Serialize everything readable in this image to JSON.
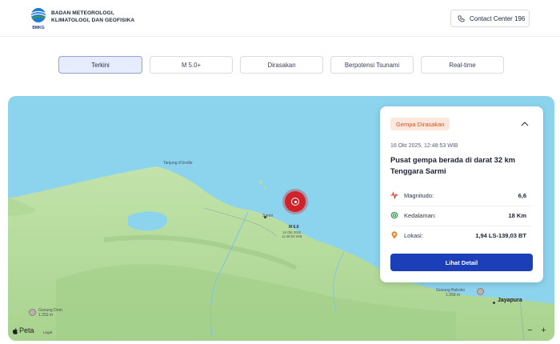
{
  "header": {
    "brand_lines": [
      "BADAN METEOROLOGI,",
      "KLIMATOLOGI, DAN GEOFISIKA"
    ],
    "logo_text": "BMKG",
    "contact_label": "Contact Center 196",
    "contact_icon": "phone-icon"
  },
  "tabs": [
    {
      "label": "Terkini",
      "active": true
    },
    {
      "label": "M 5.0+",
      "active": false
    },
    {
      "label": "Dirasakan",
      "active": false
    },
    {
      "label": "Berpotensi Tsunami",
      "active": false
    },
    {
      "label": "Real-time",
      "active": false
    }
  ],
  "map": {
    "labels": {
      "cape": "Tanjung d'Urville",
      "sarmi": "Sarmi",
      "quake_mag": "M 6.6",
      "quake_date": "16 Okt 2025",
      "quake_time": "12:48:53 WIB",
      "gunung_dom": "Gunung Dom",
      "gunung_dom_elev": "1.253 m",
      "gunung_bal": "Gunung Baboko",
      "gunung_bal_elev": "1.358 m",
      "jayapura": "Jayapura"
    },
    "attribution": "Peta",
    "legal": "Legal",
    "zoom_out": "−",
    "zoom_in": "+",
    "colors": {
      "sea": "#8cd3ee",
      "land": "#b9dca0",
      "marker": "#d0222a"
    }
  },
  "card": {
    "badge": "Gempa Dirasakan",
    "datetime": "16 Okt 2025, 12:48:53 WIB",
    "title": "Pusat gempa berada di darat 32 km Tenggara Sarmi",
    "rows": [
      {
        "label": "Magnitudo:",
        "value": "6,6",
        "icon": "activity-icon"
      },
      {
        "label": "Kedalaman:",
        "value": "18 Km",
        "icon": "depth-icon"
      },
      {
        "label": "Lokasi:",
        "value": "1,94 LS-139,03 BT",
        "icon": "location-pin-icon"
      }
    ],
    "button": "Lihat Detail"
  }
}
